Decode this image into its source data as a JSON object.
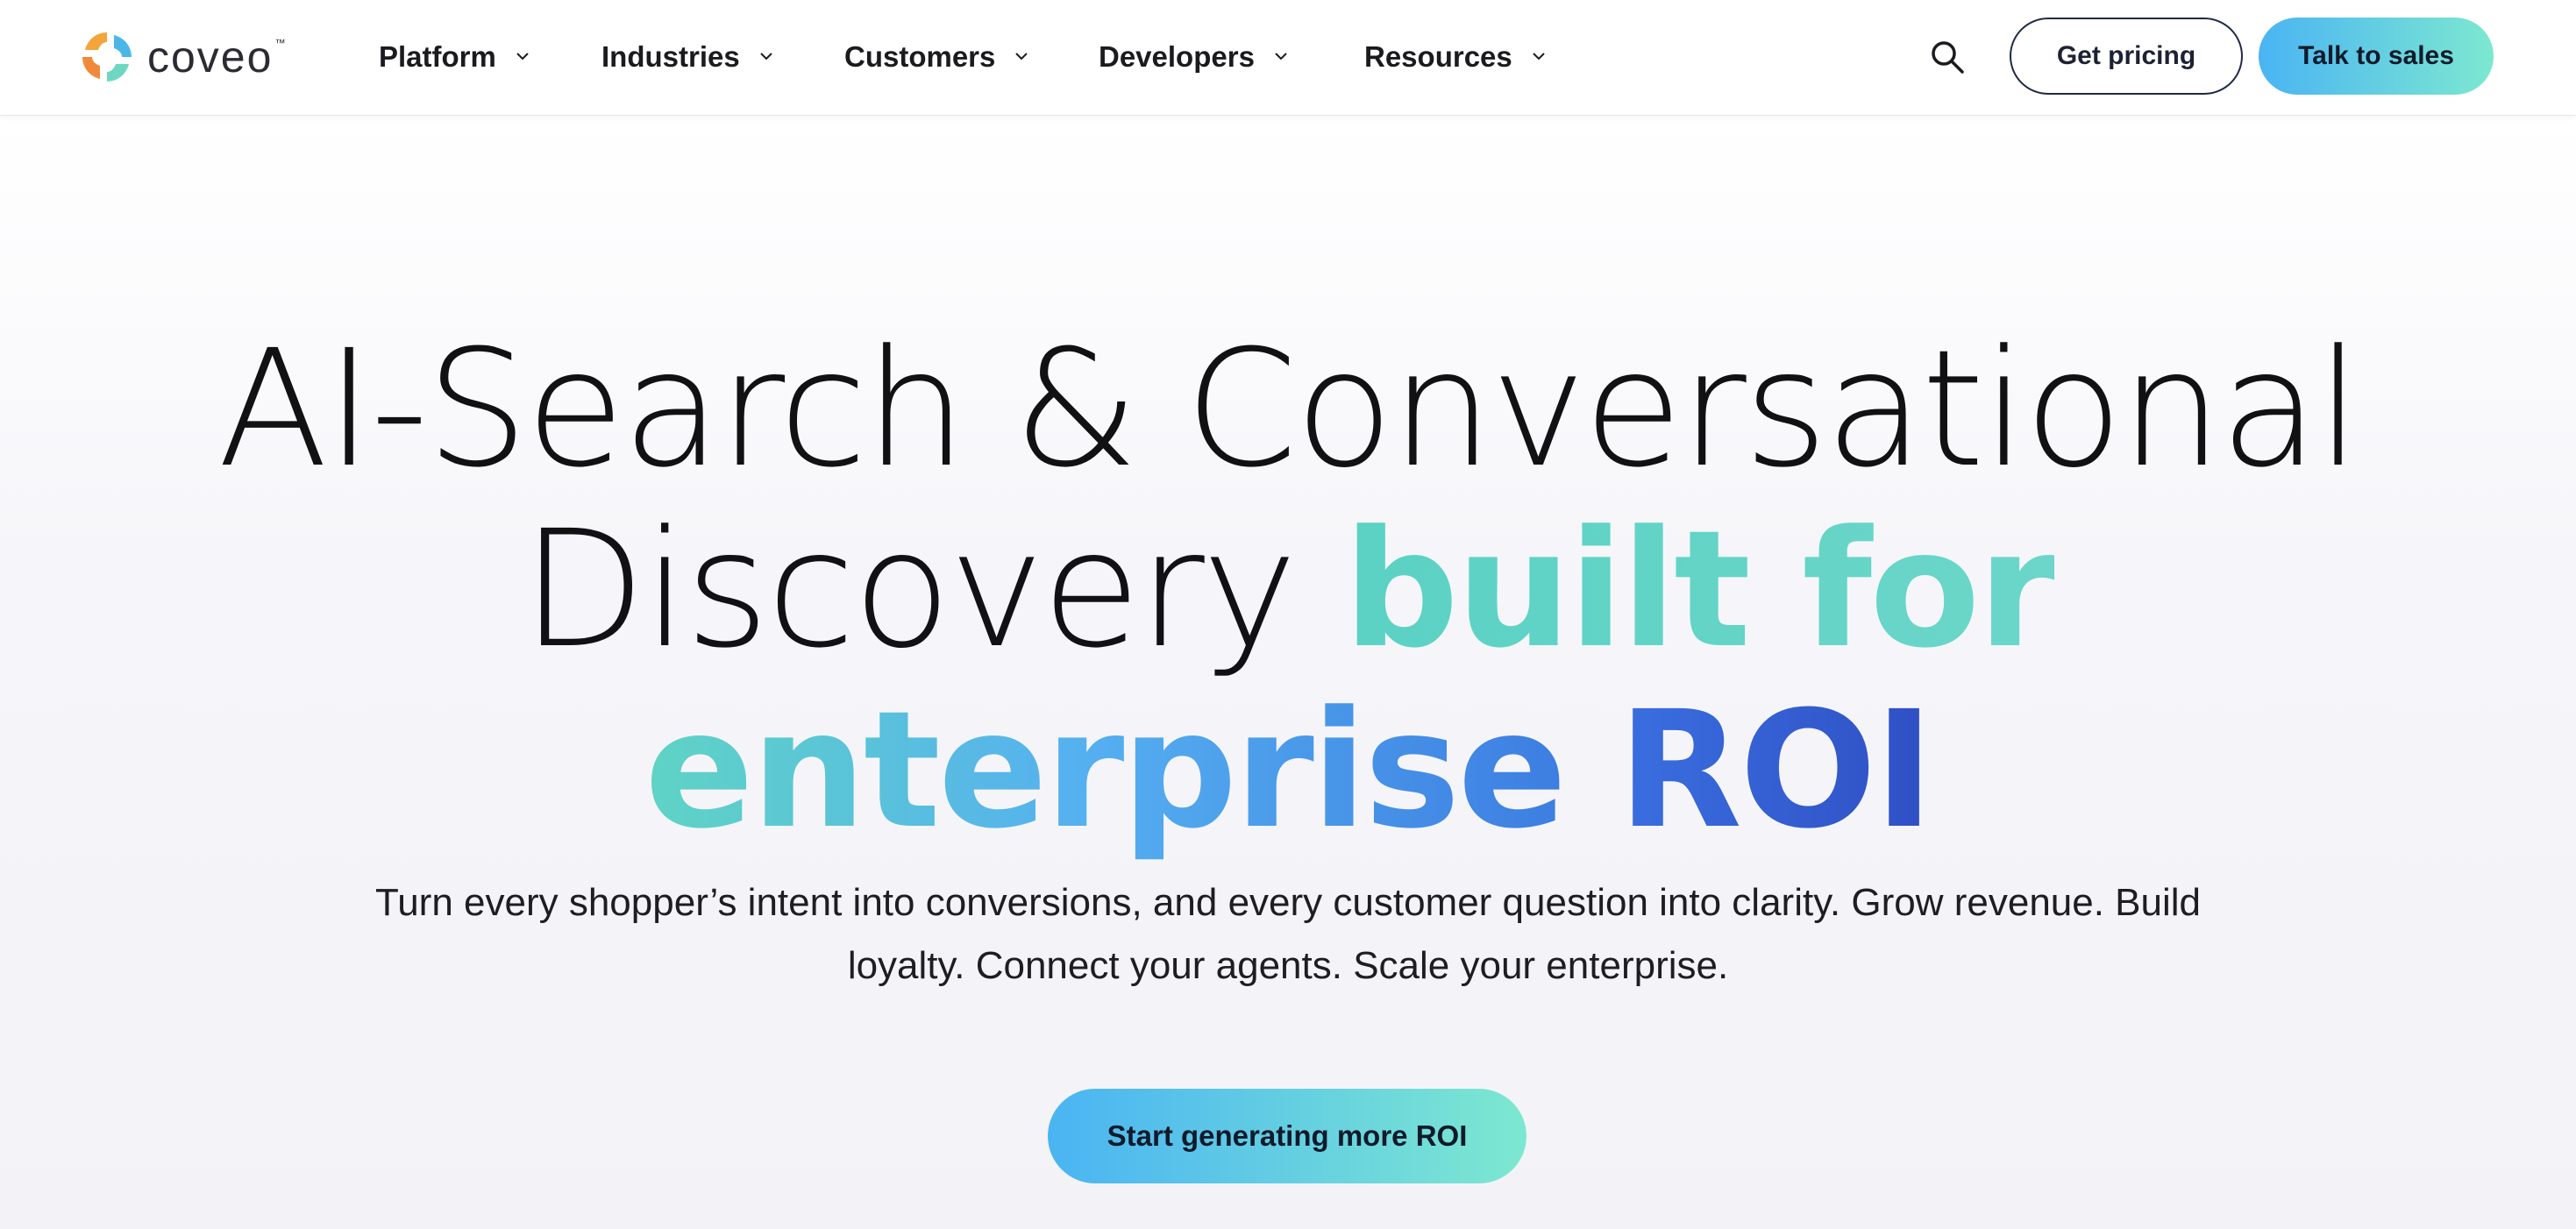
{
  "brand": {
    "name": "coveo",
    "trademark": "™",
    "logo_colors": [
      "#f3a43b",
      "#4bb7e8",
      "#6fd7c1",
      "#f08a3a"
    ]
  },
  "nav": {
    "items": [
      {
        "label": "Platform"
      },
      {
        "label": "Industries"
      },
      {
        "label": "Customers"
      },
      {
        "label": "Developers"
      },
      {
        "label": "Resources"
      }
    ],
    "search_icon": "search-icon",
    "get_pricing_label": "Get pricing",
    "talk_to_sales_label": "Talk to sales"
  },
  "hero": {
    "headline_line1": "AI-Search & Conversational",
    "headline_line2_plain": "Discovery ",
    "headline_line2_accent": "built for",
    "headline_line3_accent": "enterprise ",
    "headline_line3_strong": "ROI",
    "subtext_line1": "Turn every shopper’s intent into conversions, and every customer question into clarity. Grow revenue. Build",
    "subtext_line2": "loyalty. Connect your agents. Scale your enterprise.",
    "cta_label": "Start generating more ROI"
  },
  "colors": {
    "accent_teal": "#5bd2c4",
    "accent_blue": "#3a6fe0",
    "button_gradient_start": "#4ab4f3",
    "button_gradient_end": "#7de8d0",
    "outline_button_border": "#1e2a44"
  }
}
